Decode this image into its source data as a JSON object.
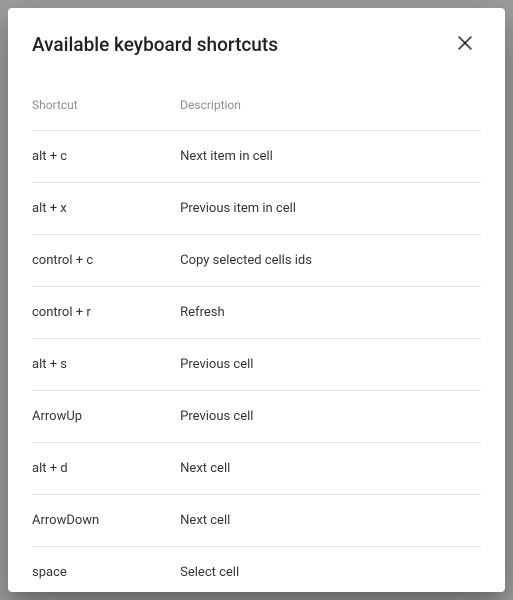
{
  "dialog": {
    "title": "Available keyboard shortcuts",
    "headers": {
      "shortcut": "Shortcut",
      "description": "Description"
    },
    "rows": [
      {
        "shortcut": "alt + c",
        "description": "Next item in cell"
      },
      {
        "shortcut": "alt + x",
        "description": "Previous item in cell"
      },
      {
        "shortcut": "control + c",
        "description": "Copy selected cells ids"
      },
      {
        "shortcut": "control + r",
        "description": "Refresh"
      },
      {
        "shortcut": "alt + s",
        "description": "Previous cell"
      },
      {
        "shortcut": "ArrowUp",
        "description": "Previous cell"
      },
      {
        "shortcut": "alt + d",
        "description": "Next cell"
      },
      {
        "shortcut": "ArrowDown",
        "description": "Next cell"
      },
      {
        "shortcut": "space",
        "description": "Select cell"
      }
    ]
  }
}
